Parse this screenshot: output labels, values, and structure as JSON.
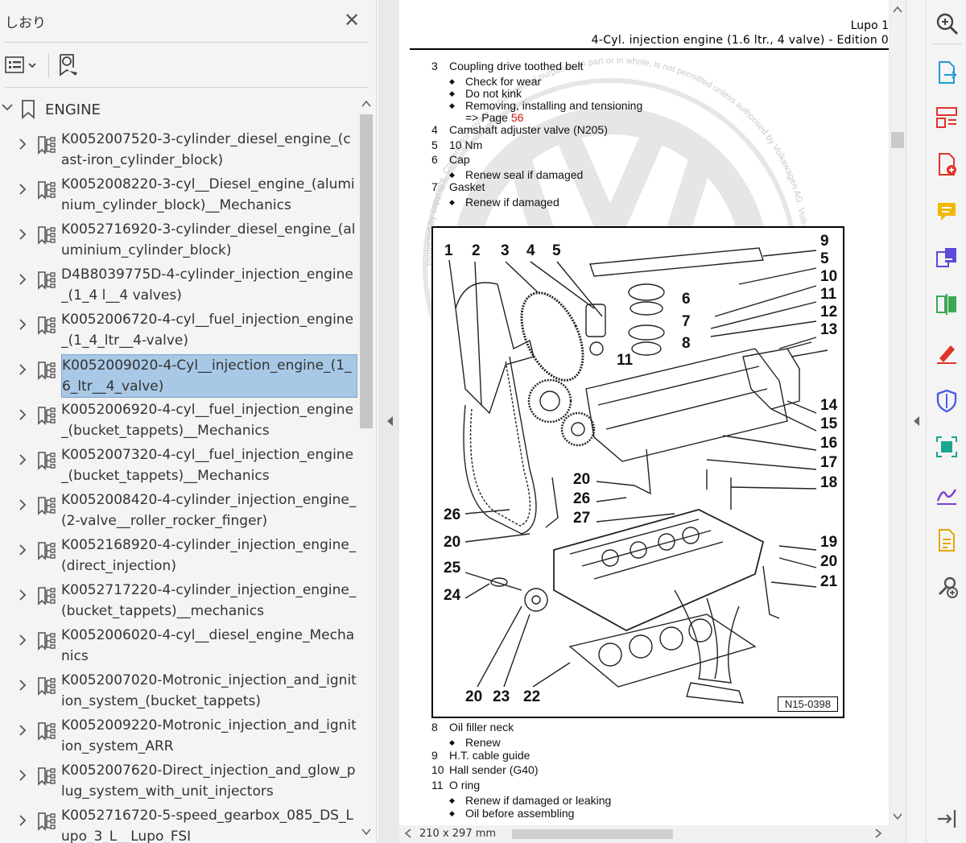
{
  "bookmarks_panel": {
    "title": "しおり",
    "root": {
      "label": "ENGINE"
    },
    "items": [
      {
        "label": "K0052007520-3-cylinder_diesel_engine_(cast-iron_cylinder_block)",
        "selected": false
      },
      {
        "label": "K0052008220-3-cyl__Diesel_engine_(aluminium_cylinder_block)__Mechanics",
        "selected": false
      },
      {
        "label": "K0052716920-3-cylinder_diesel_engine_(aluminium_cylinder_block)",
        "selected": false
      },
      {
        "label": "D4B8039775D-4-cylinder_injection_engine_(1_4 l__4 valves)",
        "selected": false
      },
      {
        "label": "K0052006720-4-cyl__fuel_injection_engine_(1_4_ltr__4-valve)",
        "selected": false
      },
      {
        "label": "K0052009020-4-Cyl__injection_engine_(1_6_ltr__4_valve)",
        "selected": true
      },
      {
        "label": "K0052006920-4-cyl__fuel_injection_engine_(bucket_tappets)__Mechanics",
        "selected": false
      },
      {
        "label": "K0052007320-4-cyl__fuel_injection_engine_(bucket_tappets)__Mechanics",
        "selected": false
      },
      {
        "label": "K0052008420-4-cylinder_injection_engine_(2-valve__roller_rocker_finger)",
        "selected": false
      },
      {
        "label": "K0052168920-4-cylinder_injection_engine_(direct_injection)",
        "selected": false
      },
      {
        "label": "K0052717220-4-cylinder_injection_engine_(bucket_tappets)__mechanics",
        "selected": false
      },
      {
        "label": "K0052006020-4-cyl__diesel_engine_Mechanics",
        "selected": false
      },
      {
        "label": "K0052007020-Motronic_injection_and_ignition_system_(bucket_tappets)",
        "selected": false
      },
      {
        "label": "K0052009220-Motronic_injection_and_ignition_system_ARR",
        "selected": false
      },
      {
        "label": "K0052007620-Direct_injection_and_glow_plug_system_with_unit_injectors",
        "selected": false
      },
      {
        "label": "K0052716720-5-speed_gearbox_085_DS_Lupo_3_L__Lupo_FSI",
        "selected": false
      }
    ]
  },
  "document": {
    "header_title": "Lupo 1",
    "header_subtitle": "4-Cyl. injection engine (1.6 ltr., 4 valve) - Edition 0",
    "lines_top": [
      {
        "num": "3",
        "text": "Coupling drive toothed belt"
      },
      {
        "bullet": "Check for wear"
      },
      {
        "bullet": "Do not kink"
      },
      {
        "bullet": "Removing, installing and tensioning"
      },
      {
        "bullet_cont_prefix": "=> Page",
        "bullet_cont_link": "56"
      },
      {
        "num": "4",
        "text": "Camshaft adjuster valve (N205)"
      },
      {
        "num": "5",
        "text": "10 Nm"
      },
      {
        "num": "6",
        "text": "Cap"
      },
      {
        "bullet": "Renew seal if damaged"
      },
      {
        "num": "7",
        "text": "Gasket"
      },
      {
        "bullet": "Renew if damaged"
      }
    ],
    "lines_bottom": [
      {
        "num": "8",
        "text": "Oil filler neck"
      },
      {
        "bullet": "Renew"
      },
      {
        "num": "9",
        "text": "H.T. cable guide"
      },
      {
        "num": "10",
        "text": "Hall sender (G40)"
      },
      {
        "num": "11",
        "text": "O ring"
      },
      {
        "bullet": "Renew if damaged or leaking"
      },
      {
        "bullet": "Oil before assembling"
      }
    ],
    "watermark_text": "Protected by copyright. Copying for private or commercial purposes, in part or in whole, is not permitted unless authorised by Volkswagen AG. Volkswagen AG does not guarantee or accept any liability with respect to the correctness of information in this document.",
    "diagram": {
      "figure_id": "N15-0398",
      "callouts_top": [
        "1",
        "2",
        "3",
        "4",
        "5"
      ],
      "callouts_right": [
        "9",
        "5",
        "10",
        "11",
        "12",
        "13",
        "14",
        "15",
        "16",
        "17",
        "18",
        "19",
        "20",
        "21"
      ],
      "callouts_mid": [
        "6",
        "7",
        "8",
        "11",
        "20",
        "26",
        "27"
      ],
      "callouts_left": [
        "26",
        "20",
        "25",
        "24"
      ],
      "callouts_bottom": [
        "20",
        "23",
        "22"
      ]
    },
    "page_size": "210 x 297 mm"
  },
  "tools": [
    {
      "icon": "zoom-icon",
      "color": "#444444"
    },
    {
      "icon": "export-pdf-icon",
      "color": "#1f9bd4"
    },
    {
      "icon": "organize-pages-icon",
      "color": "#e0342b"
    },
    {
      "icon": "create-pdf-icon",
      "color": "#e0342b"
    },
    {
      "icon": "comment-icon",
      "color": "#f2b705"
    },
    {
      "icon": "combine-files-icon",
      "color": "#5b4bd8"
    },
    {
      "icon": "compare-files-icon",
      "color": "#3aa855"
    },
    {
      "icon": "fill-sign-icon",
      "color": "#e0342b"
    },
    {
      "icon": "protect-icon",
      "color": "#4a5ee8"
    },
    {
      "icon": "scan-ocr-icon",
      "color": "#1aa58f"
    },
    {
      "icon": "request-signature-icon",
      "color": "#7a3fd0"
    },
    {
      "icon": "edit-pdf-icon",
      "color": "#e6a500"
    },
    {
      "icon": "more-tools-icon",
      "color": "#555555"
    },
    {
      "icon": "expand-panel-icon",
      "color": "#555555"
    }
  ]
}
